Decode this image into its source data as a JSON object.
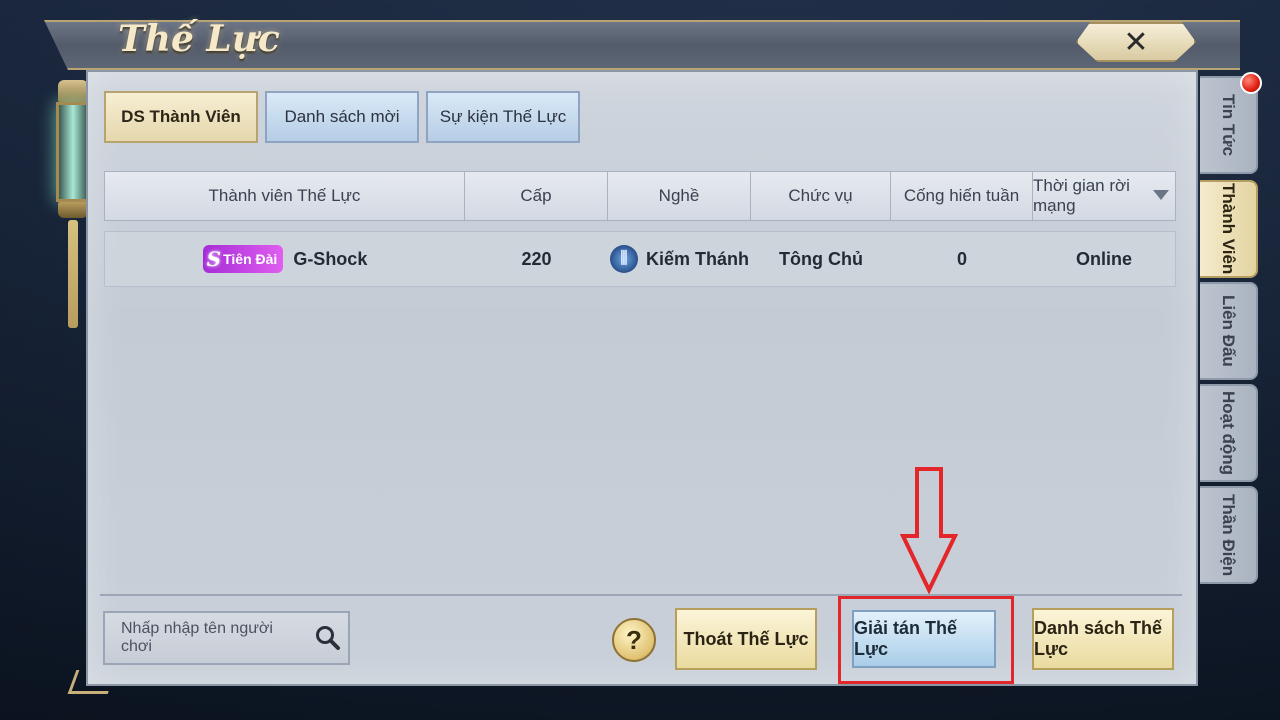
{
  "window": {
    "title": "Thế Lực",
    "close_label": "✕"
  },
  "top_tabs": [
    {
      "label": "DS Thành Viên",
      "active": true
    },
    {
      "label": "Danh sách mời",
      "active": false
    },
    {
      "label": "Sự kiện Thế Lực",
      "active": false
    }
  ],
  "table": {
    "headers": [
      "Thành viên Thế Lực",
      "Cấp",
      "Nghề",
      "Chức vụ",
      "Cống hiến tuần",
      "Thời gian rời mạng"
    ],
    "rows": [
      {
        "badge_letter": "S",
        "badge_text": "Tiên Đài",
        "name": "G-Shock",
        "level": "220",
        "profession": "Kiếm Thánh",
        "position": "Tông Chủ",
        "weekly_contribution": "0",
        "offline_time": "Online"
      }
    ]
  },
  "bottom": {
    "search_placeholder": "Nhấp nhập tên người chơi",
    "help_label": "?",
    "leave_button": "Thoát Thế Lực",
    "disband_button": "Giải tán Thế Lực",
    "list_button": "Danh sách Thế Lực"
  },
  "side_tabs": [
    {
      "label": "Tin Tức",
      "active": false,
      "notification": true
    },
    {
      "label": "Thành Viên",
      "active": true,
      "notification": false
    },
    {
      "label": "Liên Đấu",
      "active": false,
      "notification": false
    },
    {
      "label": "Hoạt động",
      "active": false,
      "notification": false
    },
    {
      "label": "Thần Điện",
      "active": false,
      "notification": false
    }
  ],
  "colors": {
    "highlight": "#e2262a",
    "badge": "#c040e6",
    "gold_button": "#eadb9f",
    "blue_button": "#a9cde8"
  },
  "icons": [
    "close-icon",
    "search-icon",
    "help-icon",
    "job-icon",
    "sort-down-icon",
    "red-arrow-icon",
    "notification-dot-icon",
    "lantern-icon"
  ]
}
